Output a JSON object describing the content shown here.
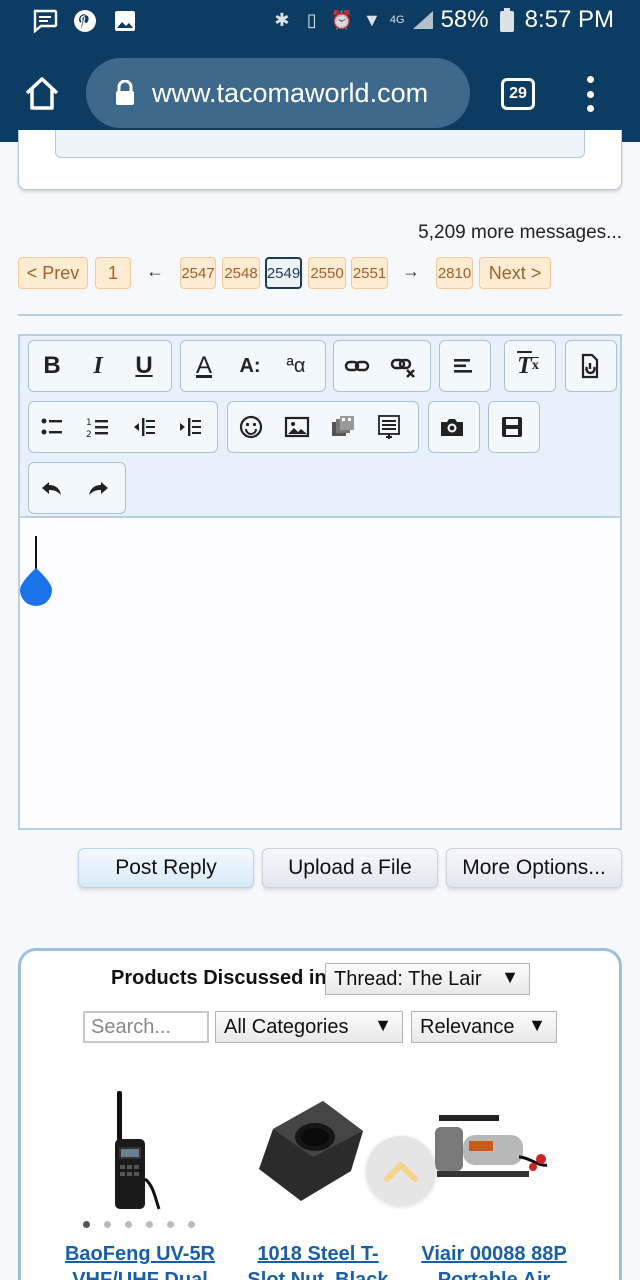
{
  "status_bar": {
    "battery": "58%",
    "time": "8:57 PM",
    "network": "4G"
  },
  "browser": {
    "url": "www.tacomaworld.com",
    "tab_count": "29"
  },
  "thread": {
    "more_messages": "5,209 more messages..."
  },
  "pagination": {
    "prev": "< Prev",
    "first": "1",
    "ellipsis_left": "←",
    "pages": [
      "2547",
      "2548",
      "2549",
      "2550",
      "2551"
    ],
    "current": "2549",
    "ellipsis_right": "→",
    "last": "2810",
    "next": "Next >"
  },
  "editor": {
    "toolbar_icons": [
      "bold-icon",
      "italic-icon",
      "underline-icon",
      "text-color-icon",
      "font-size-icon",
      "font-family-icon",
      "link-icon",
      "unlink-icon",
      "align-icon",
      "remove-format-icon",
      "toggle-bbcode-icon",
      "bullet-list-icon",
      "numbered-list-icon",
      "outdent-icon",
      "indent-icon",
      "smilie-icon",
      "image-icon",
      "media-icon",
      "quote-icon",
      "camera-icon",
      "save-draft-icon",
      "undo-icon",
      "redo-icon"
    ]
  },
  "actions": {
    "post_reply": "Post Reply",
    "upload": "Upload a File",
    "more_options": "More Options..."
  },
  "products": {
    "title": "Products Discussed in",
    "thread_select": "Thread: The Lair",
    "search_placeholder": "Search...",
    "category_select": "All Categories",
    "sort_select": "Relevance",
    "items": [
      {
        "line1": "BaoFeng UV-5R",
        "line2": "VHF/UHF Dual"
      },
      {
        "line1": "1018 Steel T-",
        "line2": "Slot Nut, Black"
      },
      {
        "line1": "Viair 00088 88P",
        "line2": "Portable Air"
      }
    ]
  },
  "colors": {
    "chrome": "#0d3c63",
    "accent": "#1a73e8",
    "pager_bg": "#fdebd2",
    "link": "#1a5ea8"
  }
}
